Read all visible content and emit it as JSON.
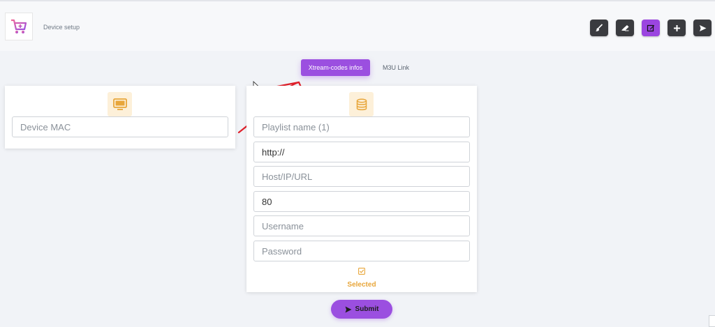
{
  "header": {
    "title": "Device setup",
    "logo_icon": "cart-plus-icon",
    "toolbar": [
      {
        "icon": "brush-icon",
        "symbol": "🖌",
        "active": false
      },
      {
        "icon": "eraser-icon",
        "symbol": "⌫",
        "active": false
      },
      {
        "icon": "edit-icon",
        "symbol": "✎",
        "active": true
      },
      {
        "icon": "plus-icon",
        "symbol": "+",
        "active": false
      },
      {
        "icon": "send-icon",
        "symbol": "➤",
        "active": false
      }
    ]
  },
  "tabs": {
    "active": "Xtream-codes infos",
    "other": "M3U Link"
  },
  "device_card": {
    "icon": "monitor-icon",
    "mac_placeholder": "Device MAC"
  },
  "playlist_card": {
    "icon": "database-icon",
    "playlist_name_placeholder": "Playlist name (1)",
    "protocol_value": "http://",
    "host_placeholder": "Host/IP/URL",
    "port_value": "80",
    "username_placeholder": "Username",
    "password_placeholder": "Password",
    "selected_label": "Selected"
  },
  "submit": {
    "label": "Submit",
    "icon": "send-icon"
  },
  "colors": {
    "accent": "#9b4fe0",
    "icon_bg": "#fdf0d9",
    "icon_fg": "#e8a63a",
    "annotation": "#e0202a"
  }
}
